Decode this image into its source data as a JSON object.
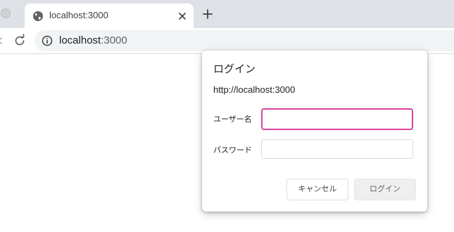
{
  "browser": {
    "tab": {
      "title": "localhost:3000",
      "favicon_icon": "globe-icon",
      "close_icon": "close-icon"
    },
    "new_tab_icon": "plus-icon",
    "toolbar": {
      "back_icon": "back-arrow-icon",
      "reload_icon": "reload-icon",
      "site_info_icon": "info-icon",
      "url_host": "localhost",
      "url_port": ":3000"
    }
  },
  "dialog": {
    "title": "ログイン",
    "origin": "http://localhost:3000",
    "username_label": "ユーザー名",
    "username_value": "",
    "password_label": "パスワード",
    "password_value": "",
    "cancel_label": "キャンセル",
    "login_label": "ログイン",
    "focus_color": "#d9439a"
  }
}
